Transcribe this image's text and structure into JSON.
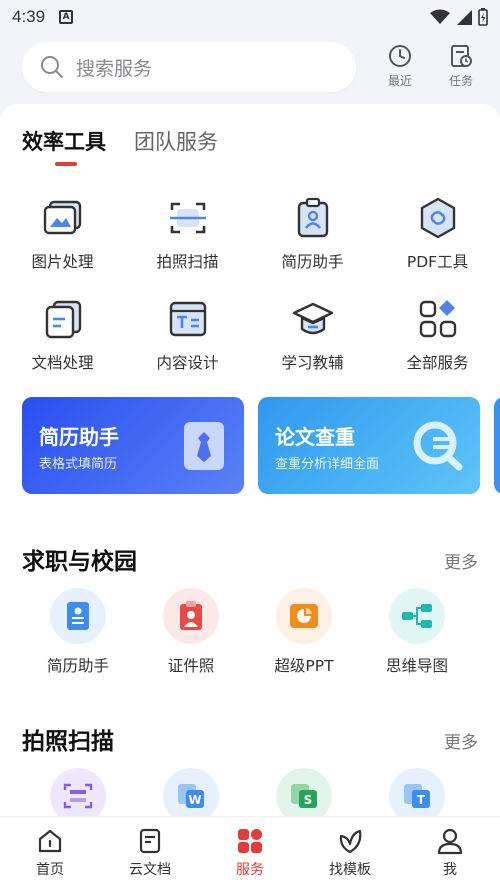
{
  "status": {
    "time": "4:39",
    "notif": "A"
  },
  "search": {
    "placeholder": "搜索服务"
  },
  "top_actions": [
    {
      "label": "最近"
    },
    {
      "label": "任务"
    }
  ],
  "tabs": [
    {
      "label": "效率工具"
    },
    {
      "label": "团队服务"
    }
  ],
  "tools": [
    {
      "label": "图片处理",
      "icon": "image-icon"
    },
    {
      "label": "拍照扫描",
      "icon": "scan-icon"
    },
    {
      "label": "简历助手",
      "icon": "resume-icon"
    },
    {
      "label": "PDF工具",
      "icon": "pdf-icon"
    },
    {
      "label": "文档处理",
      "icon": "document-icon"
    },
    {
      "label": "内容设计",
      "icon": "design-icon"
    },
    {
      "label": "学习教辅",
      "icon": "graduation-cap-icon"
    },
    {
      "label": "全部服务",
      "icon": "all-services-icon"
    }
  ],
  "banners": [
    {
      "title": "简历助手",
      "subtitle": "表格式填简历"
    },
    {
      "title": "论文查重",
      "subtitle": "查重分析详细全面"
    }
  ],
  "section1": {
    "title": "求职与校园",
    "more": "更多",
    "items": [
      {
        "label": "简历助手"
      },
      {
        "label": "证件照"
      },
      {
        "label": "超级PPT"
      },
      {
        "label": "思维导图"
      }
    ]
  },
  "section2": {
    "title": "拍照扫描",
    "more": "更多"
  },
  "nav": [
    {
      "label": "首页"
    },
    {
      "label": "云文档"
    },
    {
      "label": "服务"
    },
    {
      "label": "找模板"
    },
    {
      "label": "我"
    }
  ],
  "colors": {
    "accent": "#e23d3d",
    "banner1": "#3a5cf0",
    "banner2": "#2aa2f0"
  }
}
